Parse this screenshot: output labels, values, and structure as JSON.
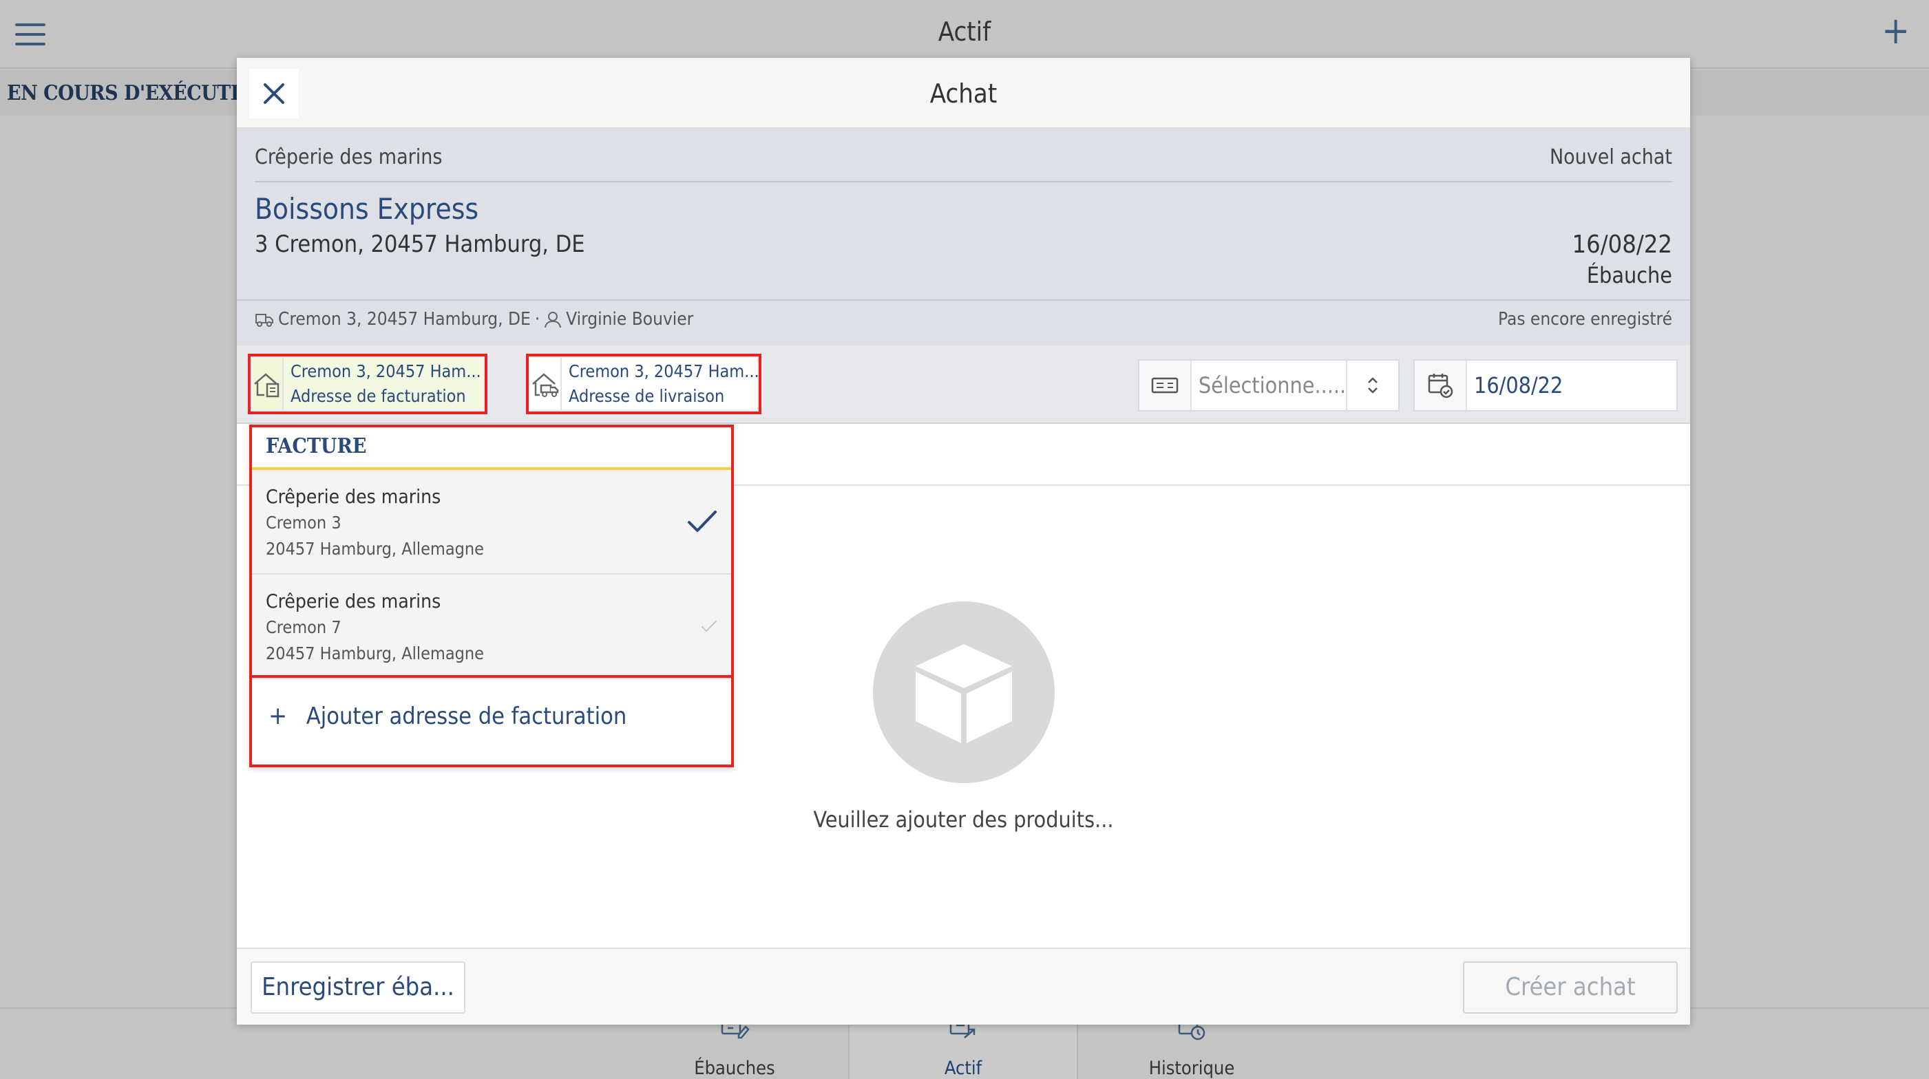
{
  "app": {
    "title": "Actif",
    "section_label": "EN COURS D'EXÉCUTION",
    "tabs": [
      {
        "label": "Ébauches",
        "icon": "draft-icon",
        "active": false
      },
      {
        "label": "Actif",
        "icon": "active-purchase-icon",
        "active": true
      },
      {
        "label": "Historique",
        "icon": "history-icon",
        "active": false
      }
    ]
  },
  "modal": {
    "title": "Achat",
    "shop": "Crêperie des marins",
    "status_top": "Nouvel achat",
    "supplier": "Boissons Express",
    "supplier_address": "3 Cremon, 20457 Hamburg, DE",
    "date": "16/08/22",
    "draft_status": "Ébauche",
    "meta_address": "Cremon 3, 20457 Hamburg, DE",
    "meta_separator": "·",
    "meta_contact": "Virginie Bouvier",
    "save_status": "Pas encore enregistré"
  },
  "toolbar": {
    "billing_line1": "Cremon 3, 20457 Ham...",
    "billing_line2": "Adresse de facturation",
    "delivery_line1": "Cremon 3, 20457 Ham...",
    "delivery_line2": "Adresse de livraison",
    "payment_placeholder": "Sélectionne.....",
    "date_value": "16/08/22"
  },
  "empty": {
    "text": "Veuillez ajouter des produits..."
  },
  "footer": {
    "save_draft": "Enregistrer éba...",
    "create": "Créer achat"
  },
  "dropdown": {
    "header": "FACTURE",
    "items": [
      {
        "name": "Crêperie des marins",
        "street": "Cremon 3",
        "city": "20457 Hamburg, Allemagne",
        "selected": true
      },
      {
        "name": "Crêperie des marins",
        "street": "Cremon 7",
        "city": "20457 Hamburg, Allemagne",
        "selected": false
      }
    ],
    "add_label": "Ajouter adresse de facturation",
    "add_symbol": "+"
  },
  "colors": {
    "accent": "#2a4a7b",
    "highlight": "#e52420",
    "dropdown_rule": "#f5cf48"
  }
}
